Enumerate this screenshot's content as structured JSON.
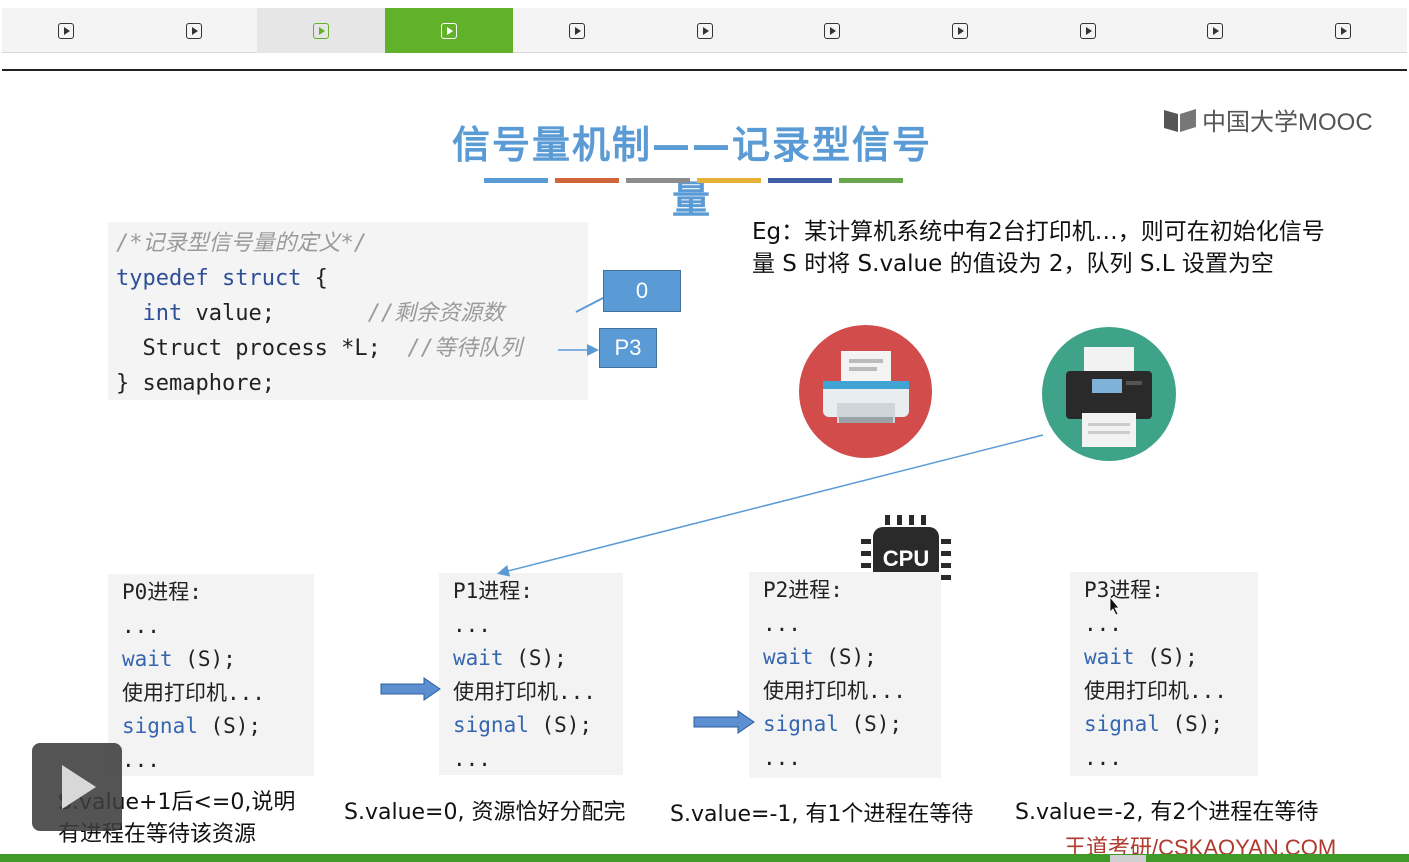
{
  "chapter_bar": {
    "segments": [
      {
        "icon": "play-square-icon",
        "state": "normal"
      },
      {
        "icon": "play-square-icon",
        "state": "normal"
      },
      {
        "icon": "play-square-icon",
        "state": "visited"
      },
      {
        "icon": "play-square-icon",
        "state": "active"
      },
      {
        "icon": "play-square-icon",
        "state": "normal"
      },
      {
        "icon": "play-square-icon",
        "state": "normal"
      },
      {
        "icon": "play-square-icon",
        "state": "normal"
      },
      {
        "icon": "play-square-icon",
        "state": "normal"
      },
      {
        "icon": "play-square-icon",
        "state": "normal"
      },
      {
        "icon": "play-square-icon",
        "state": "normal"
      },
      {
        "icon": "play-square-icon",
        "state": "normal"
      }
    ],
    "active_color": "#61b22a"
  },
  "slide": {
    "title": "信号量机制——记录型信号量",
    "title_color": "#5b9bd5",
    "divider_colors": [
      "#5b9bd5",
      "#d0643a",
      "#8c8c8c",
      "#e8b23a",
      "#3e5ea8",
      "#6aa84f"
    ],
    "logo_text": "中国大学MOOC",
    "code_definition": {
      "line1": "/*记录型信号量的定义*/",
      "line2_kw": "typedef struct",
      "line2_rest": " {",
      "line3_kw": "int",
      "line3_rest": " value;",
      "line3_comment": "//剩余资源数",
      "line4": "  Struct process *L;",
      "line4_comment": "//等待队列",
      "line5": "} semaphore;"
    },
    "value_box": "0",
    "queue_box": "P3",
    "example_text": "Eg：某计算机系统中有2台打印机…，则可在初始化信号量 S 时将 S.value 的值设为 2，队列 S.L 设置为空",
    "cpu_label": "CPU",
    "processes": [
      {
        "name": "P0进程:",
        "dots1": "...",
        "wait_kw": "wait",
        "wait_arg": " (S);",
        "use": "使用打印机...",
        "signal_kw": "signal",
        "signal_arg": " (S);",
        "dots2": "..."
      },
      {
        "name": "P1进程:",
        "dots1": "...",
        "wait_kw": "wait",
        "wait_arg": " (S);",
        "use": "使用打印机...",
        "signal_kw": "signal",
        "signal_arg": " (S);",
        "dots2": "..."
      },
      {
        "name": "P2进程:",
        "dots1": "...",
        "wait_kw": "wait",
        "wait_arg": " (S);",
        "use": "使用打印机...",
        "signal_kw": "signal",
        "signal_arg": " (S);",
        "dots2": "..."
      },
      {
        "name": "P3进程:",
        "dots1": "...",
        "wait_kw": "wait",
        "wait_arg": " (S);",
        "use": "使用打印机...",
        "signal_kw": "signal",
        "signal_arg": " (S);",
        "dots2": "..."
      }
    ],
    "captions": {
      "p0_line1": "S.value+1后<=0,说明",
      "p0_line2": "有进程在等待该资源",
      "p1": "S.value=0, 资源恰好分配完",
      "p2": "S.value=-1, 有1个进程在等待",
      "p3": "S.value=-2, 有2个进程在等待"
    },
    "watermark": "王道考研/CSKAOYAN.COM"
  },
  "player": {
    "play_icon": "play-icon",
    "progress_color": "#3f9a2a"
  }
}
